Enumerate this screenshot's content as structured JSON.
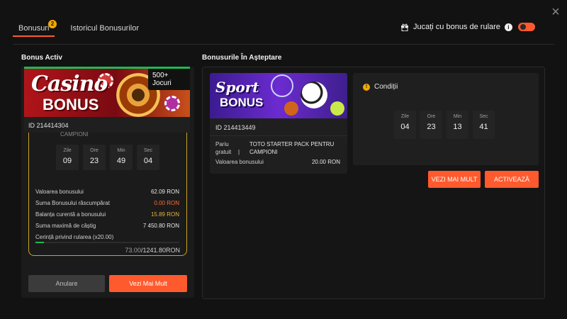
{
  "window": {
    "close_symbol": "×"
  },
  "tabs": [
    {
      "label": "Bonusuri",
      "badge": "2",
      "active": true
    },
    {
      "label": "Istoricul Bonusurilor",
      "active": false
    }
  ],
  "toggle": {
    "label": "Jucați cu bonus de rulare",
    "info": "i",
    "enabled": true
  },
  "active_section": {
    "title": "Bonus Activ",
    "banner_title": "Casino",
    "banner_subtitle": "BONUS",
    "games_pill": "500+ Jocuri",
    "id_text": "ID 214414304",
    "cut_label": "CAMPIONI",
    "timer": [
      {
        "label": "Zile",
        "value": "09"
      },
      {
        "label": "Ore",
        "value": "23"
      },
      {
        "label": "Min",
        "value": "49"
      },
      {
        "label": "Sec",
        "value": "04"
      }
    ],
    "details": [
      {
        "label": "Valoarea bonusului",
        "value": "62.09 RON"
      },
      {
        "label": "Suma Bonusului răscumpărat",
        "value": "0.00 RON"
      },
      {
        "label": "Balanța curentă a bonusului",
        "value": "15.89 RON"
      },
      {
        "label": "Suma maximă de câștig",
        "value": "7 450.80 RON"
      },
      {
        "label": "Cerință privind rularea (x20.00)",
        "value": ""
      }
    ],
    "progress": {
      "current": "73.00",
      "total": "/1241.80RON",
      "fraction": 0.06
    },
    "cancel_label": "Anulare",
    "more_label": "Vezi Mai Mult"
  },
  "pending_section": {
    "title": "Bonusurile În Așteptare",
    "banner_title": "Sport",
    "banner_subtitle": "BONUS",
    "id_text": "ID 214413449",
    "bet_label_1": "Pariu",
    "bet_label_2": "gratuit",
    "bet_sep": "|",
    "bet_value_1": "TOTO STARTER PACK PENTRU",
    "bet_value_2": "CAMPIONI",
    "value_label": "Valoarea bonusului",
    "value": "20.00 RON",
    "conditions_title": "Condiții",
    "conditions_icon": "!",
    "timer": [
      {
        "label": "Zile",
        "value": "04"
      },
      {
        "label": "Ore",
        "value": "23"
      },
      {
        "label": "Min",
        "value": "13"
      },
      {
        "label": "Sec",
        "value": "41"
      }
    ],
    "more_label": "VEZI MAI MULT",
    "activate_label": "ACTIVEAZĂ"
  }
}
